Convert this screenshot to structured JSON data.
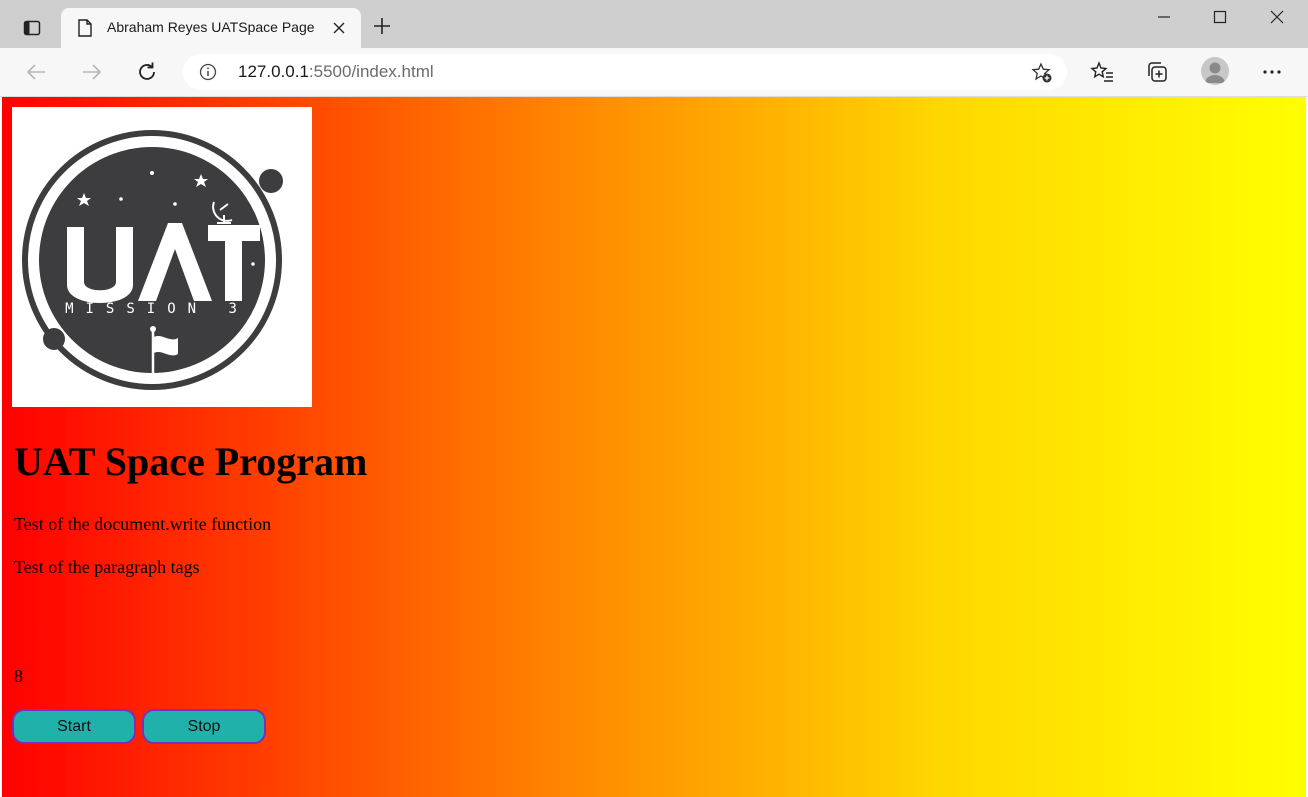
{
  "browser": {
    "tab": {
      "title": "Abraham Reyes UATSpace Page"
    },
    "address": {
      "host": "127.0.0.1",
      "path": ":5500/index.html"
    }
  },
  "page": {
    "logo": {
      "title": "UAT",
      "subtitle": "MISSION 3"
    },
    "heading": "UAT Space Program",
    "paragraphs": [
      "Test of the document.write function",
      "Test of the paragraph tags"
    ],
    "counter": "8",
    "buttons": {
      "start": "Start",
      "stop": "Stop"
    },
    "colors": {
      "gradient_start": "#ff0000",
      "gradient_mid": "#ff8c00",
      "gradient_end": "#ffff00",
      "button_fill": "#20b2aa",
      "button_border": "#7b2fbe"
    }
  }
}
